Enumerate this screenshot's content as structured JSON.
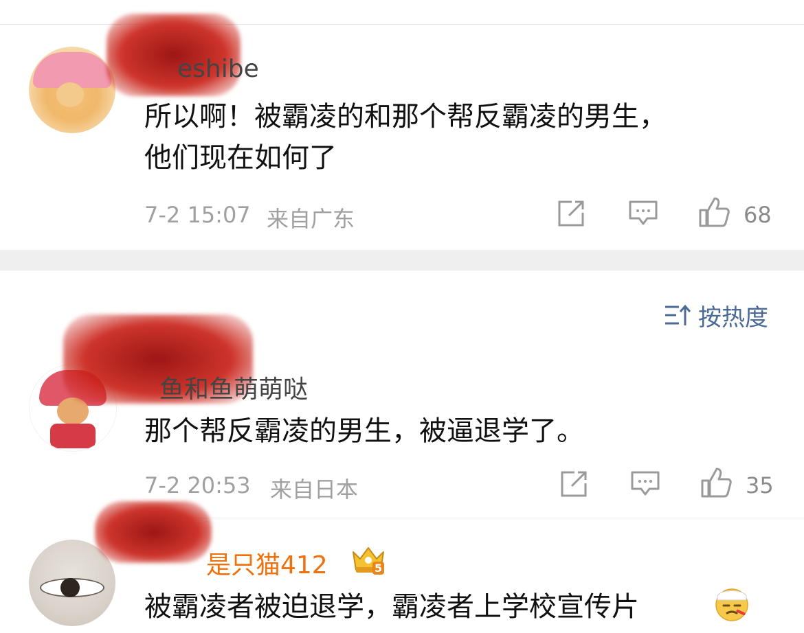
{
  "sort": {
    "label": "按热度",
    "icon": "sort-icon"
  },
  "comments": [
    {
      "username": "eshibe",
      "text_lines": [
        "所以啊！被霸凌的和那个帮反霸凌的男生，",
        "他们现在如何了"
      ],
      "time": "7-2 15:07",
      "location": "来自广东",
      "likes": "68"
    },
    {
      "username": "鱼和鱼萌萌哒",
      "text_lines": [
        "那个帮反霸凌的男生，被逼退学了。"
      ],
      "time": "7-2 20:53",
      "location": "来自日本",
      "likes": "35"
    },
    {
      "username": "是只猫412",
      "text_lines": [
        "被霸凌者被迫退学，霸凌者上学校宣传片"
      ],
      "emoji": "sick-face-emoji",
      "badge": "crown-badge",
      "badge_level": "5"
    }
  ],
  "colors": {
    "username_vip": "#f0700c",
    "sort_link": "#4b6a97",
    "meta": "#a0a0a0",
    "separator": "#efefef"
  }
}
